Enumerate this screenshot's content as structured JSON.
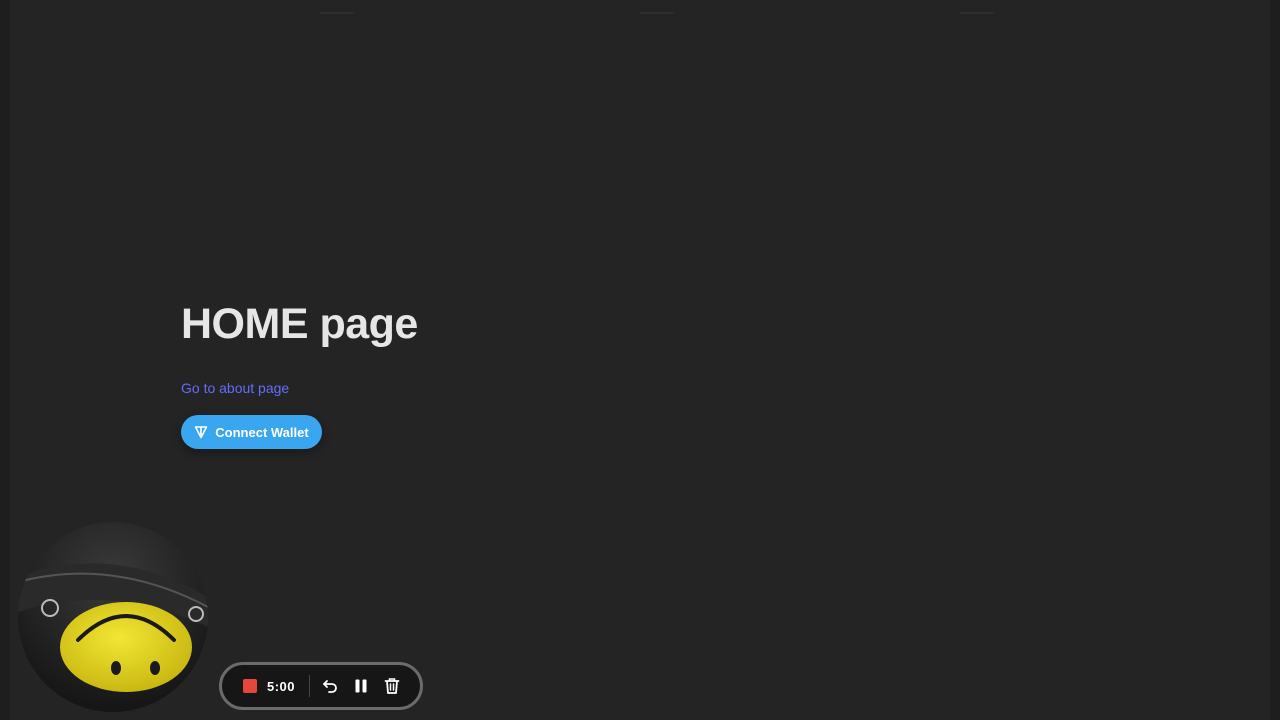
{
  "page": {
    "title": "HOME page",
    "about_link": "Go to about page",
    "connect_label": "Connect Wallet"
  },
  "recorder": {
    "timer": "5:00",
    "stop_color": "#e5483b",
    "tools": [
      "undo-icon",
      "pause-icon",
      "trash-icon"
    ]
  },
  "colors": {
    "background": "#242424",
    "link": "#646cff",
    "connect_button": "#3aa6ef"
  },
  "icons": {
    "connect": "ton-icon"
  }
}
